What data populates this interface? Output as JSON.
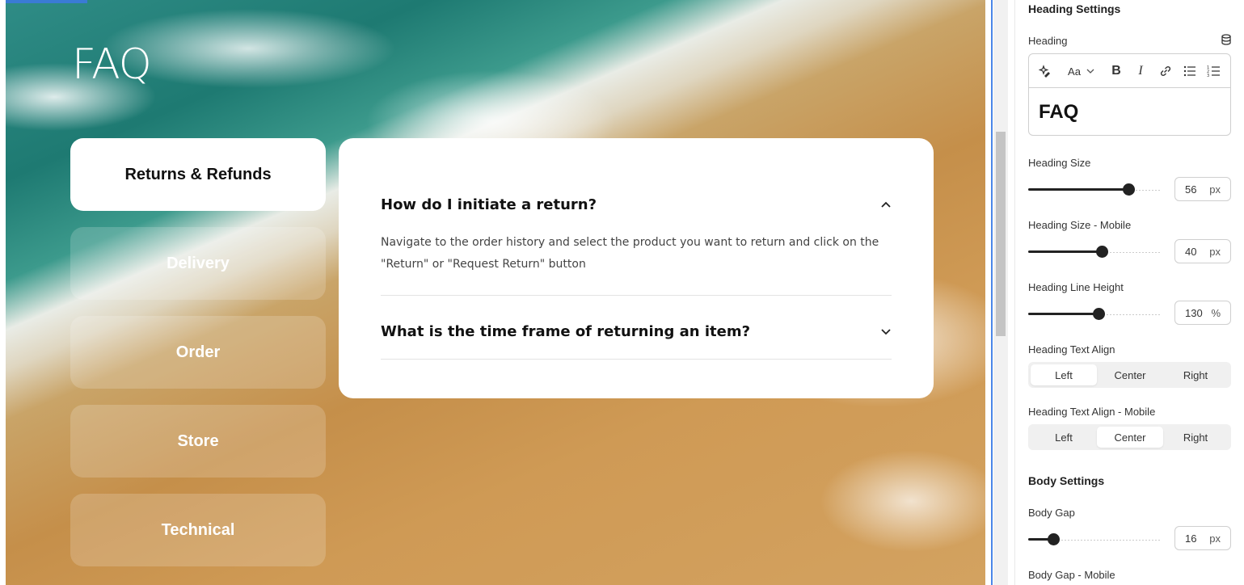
{
  "preview": {
    "title": "FAQ",
    "categories": [
      {
        "label": "Returns & Refunds",
        "active": true
      },
      {
        "label": "Delivery",
        "active": false
      },
      {
        "label": "Order",
        "active": false
      },
      {
        "label": "Store",
        "active": false
      },
      {
        "label": "Technical",
        "active": false
      }
    ],
    "questions": [
      {
        "question": "How do I initiate a return?",
        "expanded": true,
        "answer_line1": "Navigate to the order history and select the product you want to return and click on the",
        "answer_line2": "\"Return\" or \"Request Return\" button"
      },
      {
        "question": "What is the time frame of returning an item?",
        "expanded": false
      }
    ]
  },
  "panel": {
    "heading_settings_title": "Heading Settings",
    "heading_label": "Heading",
    "toolbar": {
      "ai_icon": "sparkle-icon",
      "text_style": "Aa",
      "bold": "B",
      "italic": "I",
      "link_icon": "link-icon",
      "bullets_icon": "bullet-list-icon",
      "numbered_icon": "numbered-list-icon"
    },
    "heading_value": "FAQ",
    "heading_size": {
      "label": "Heading Size",
      "value": "56",
      "unit": "px",
      "fraction": 0.75
    },
    "heading_size_mobile": {
      "label": "Heading Size - Mobile",
      "value": "40",
      "unit": "px",
      "fraction": 0.55
    },
    "heading_line_height": {
      "label": "Heading Line Height",
      "value": "130",
      "unit": "%",
      "fraction": 0.53
    },
    "heading_text_align": {
      "label": "Heading Text Align",
      "options": [
        "Left",
        "Center",
        "Right"
      ],
      "selected": "Left"
    },
    "heading_text_align_mobile": {
      "label": "Heading Text Align - Mobile",
      "options": [
        "Left",
        "Center",
        "Right"
      ],
      "selected": "Center"
    },
    "body_settings_title": "Body Settings",
    "body_gap": {
      "label": "Body Gap",
      "value": "16",
      "unit": "px",
      "fraction": 0.19
    },
    "body_gap_mobile": {
      "label": "Body Gap - Mobile"
    }
  },
  "colors": {
    "accent": "#4a86e8",
    "knob": "#222222"
  }
}
